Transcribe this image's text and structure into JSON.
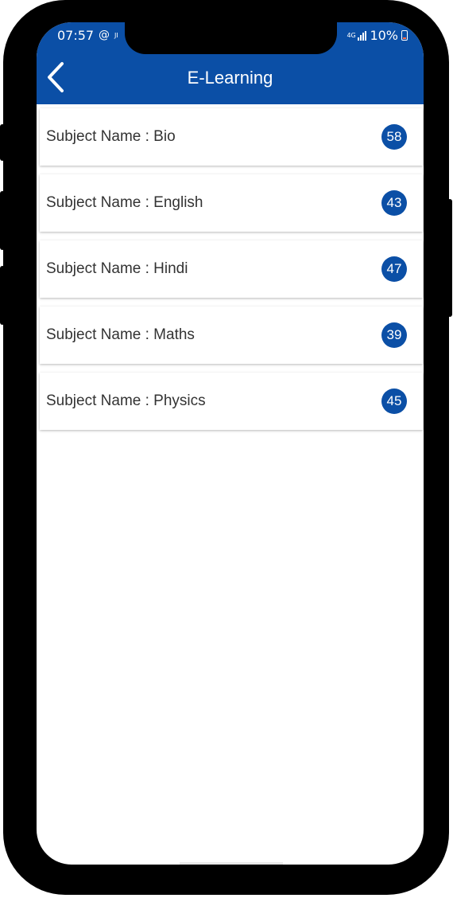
{
  "status_bar": {
    "time": "07:57",
    "left_icons": [
      "at-icon",
      "carrier-icon"
    ],
    "carrier_text": "JI",
    "network_label": "4G",
    "battery_percent": "10%",
    "battery_level": 10
  },
  "app_bar": {
    "title": "E-Learning",
    "back_icon": "chevron-left-icon",
    "color": "#0b4fa6"
  },
  "subjects": [
    {
      "label": "Subject Name : Bio",
      "count": "58"
    },
    {
      "label": "Subject Name : English",
      "count": "43"
    },
    {
      "label": "Subject Name : Hindi",
      "count": "47"
    },
    {
      "label": "Subject Name : Maths",
      "count": "39"
    },
    {
      "label": "Subject Name : Physics",
      "count": "45"
    }
  ],
  "colors": {
    "accent": "#0b4fa6",
    "background": "#ffffff",
    "text": "#333333"
  }
}
